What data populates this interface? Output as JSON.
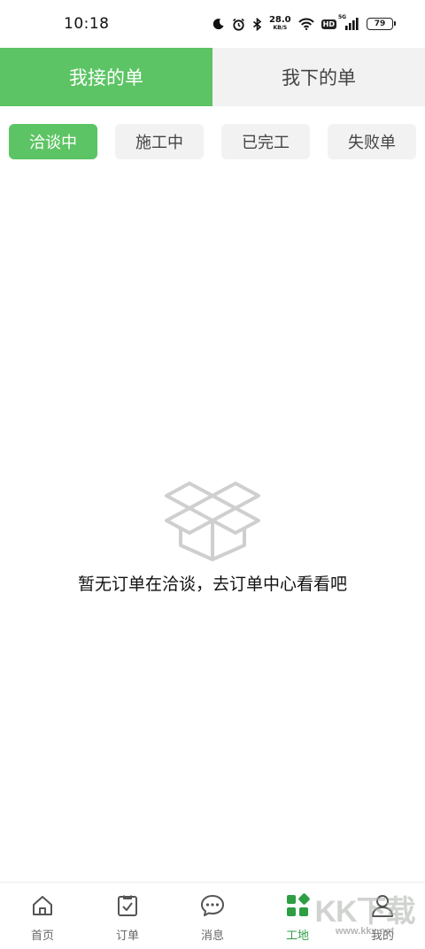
{
  "status_bar": {
    "time": "10:18",
    "network_speed_value": "28.0",
    "network_speed_unit": "KB/S",
    "hd_badge": "HD",
    "signal_label": "5G",
    "battery": "79"
  },
  "main_tabs": [
    {
      "label": "我接的单",
      "active": true
    },
    {
      "label": "我下的单",
      "active": false
    }
  ],
  "filter_tabs": [
    {
      "label": "洽谈中",
      "active": true
    },
    {
      "label": "施工中",
      "active": false
    },
    {
      "label": "已完工",
      "active": false
    },
    {
      "label": "失败单",
      "active": false
    }
  ],
  "empty_state": {
    "icon": "empty-box-icon",
    "message": "暂无订单在洽谈，去订单中心看看吧"
  },
  "bottom_nav": [
    {
      "label": "首页",
      "icon": "home-icon",
      "active": false
    },
    {
      "label": "订单",
      "icon": "clipboard-check-icon",
      "active": false
    },
    {
      "label": "消息",
      "icon": "chat-bubble-icon",
      "active": false
    },
    {
      "label": "工地",
      "icon": "grid-blocks-icon",
      "active": true
    },
    {
      "label": "我的",
      "icon": "user-icon",
      "active": false
    }
  ],
  "watermark": {
    "big": "KK下载",
    "small": "www.kkx.net"
  },
  "colors": {
    "accent": "#5cc464",
    "nav_active": "#2e9e44",
    "tab_inactive_bg": "#f2f2f2"
  }
}
